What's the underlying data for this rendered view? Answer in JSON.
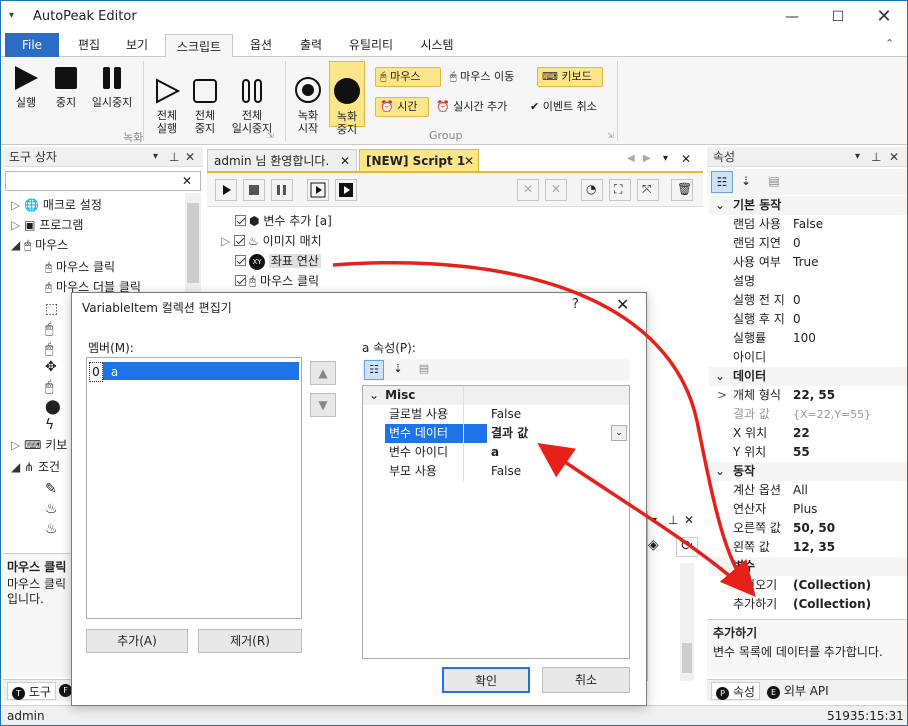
{
  "app": {
    "title": "AutoPeak Editor"
  },
  "menu": {
    "file": "File",
    "items": [
      "편집",
      "보기",
      "스크립트",
      "옵션",
      "출력",
      "유틸리티",
      "시스템"
    ]
  },
  "ribbon": {
    "record_buttons": [
      "실행",
      "중지",
      "일시중지"
    ],
    "all_buttons": [
      "전체\n실행",
      "전체\n중지",
      "전체\n일시중지"
    ],
    "rec_start": "녹화\n시작",
    "rec_stop": "녹화\n중지",
    "group_record": "녹화",
    "group_group": "Group",
    "toggle_mouse": "마우스",
    "toggle_mouse_move": "마우스 이동",
    "toggle_keyboard": "키보드",
    "toggle_time": "시간",
    "toggle_realtime": "실시간 추가",
    "toggle_event_cancel": "이벤트 취소"
  },
  "toolbox": {
    "title": "도구 상자",
    "items": [
      "매크로 설정",
      "프로그램",
      "마우스",
      "마우스 클릭",
      "마우스 더블 클릭",
      "키보",
      "조건"
    ],
    "desc_title": "마우스 클릭",
    "desc_body": "마우스 클릭\n입니다."
  },
  "tabs": {
    "welcome": "admin 님 환영합니다.",
    "script": "[NEW] Script 1"
  },
  "script": {
    "rows": [
      "변수 추가 [a]",
      "이미지 매치",
      "좌표 연산",
      "마우스 클릭"
    ]
  },
  "properties": {
    "title": "속성",
    "sections": [
      {
        "name": "기본 동작",
        "rows": [
          [
            "랜덤 사용",
            "False"
          ],
          [
            "랜덤 지연",
            "0"
          ],
          [
            "사용 여부",
            "True"
          ],
          [
            "설명",
            ""
          ],
          [
            "실행 전 지",
            "0"
          ],
          [
            "실행 후 지",
            "0"
          ],
          [
            "실행률",
            "100"
          ],
          [
            "아이디",
            ""
          ]
        ]
      },
      {
        "name": "데이터",
        "rows": [
          [
            "개체 형식",
            "22, 55"
          ],
          [
            "결과 값",
            "{X=22,Y=55}"
          ],
          [
            "X 위치",
            "22"
          ],
          [
            "Y 위치",
            "55"
          ]
        ]
      },
      {
        "name": "동작",
        "rows": [
          [
            "계산 옵션",
            "All"
          ],
          [
            "연산자",
            "Plus"
          ],
          [
            "오른쪽 값",
            "50, 50"
          ],
          [
            "왼쪽 값",
            "12, 35"
          ]
        ]
      },
      {
        "name": "변수",
        "rows": [
          [
            "가져오기",
            "(Collection)"
          ],
          [
            "추가하기",
            "(Collection)"
          ]
        ]
      }
    ],
    "desc_title": "추가하기",
    "desc_body": "변수 목록에 데이터를 추가합니다.",
    "bottom_tabs": [
      "속성",
      "외부 API"
    ]
  },
  "dialog": {
    "title": "VariableItem 컬렉션 편집기",
    "help": "?",
    "close": "✕",
    "members_label": "멤버(M):",
    "member_index": "0",
    "member_name": "a",
    "props_label": "a 속성(P):",
    "category": "Misc",
    "rows": [
      [
        "글로벌 사용",
        "False"
      ],
      [
        "변수 데이터",
        "결과 값"
      ],
      [
        "변수 아이디",
        "a"
      ],
      [
        "부모 사용",
        "False"
      ]
    ],
    "add": "추가(A)",
    "remove": "제거(R)",
    "ok": "확인",
    "cancel": "취소"
  },
  "left_bottom_tabs": [
    "도구"
  ],
  "status": {
    "user": "admin",
    "clock": "51935:15:31"
  },
  "colors": {
    "accent": "#2b6cc4",
    "highlight": "#fde68a",
    "selection": "#1e73e8",
    "arrow": "#e8201a"
  }
}
